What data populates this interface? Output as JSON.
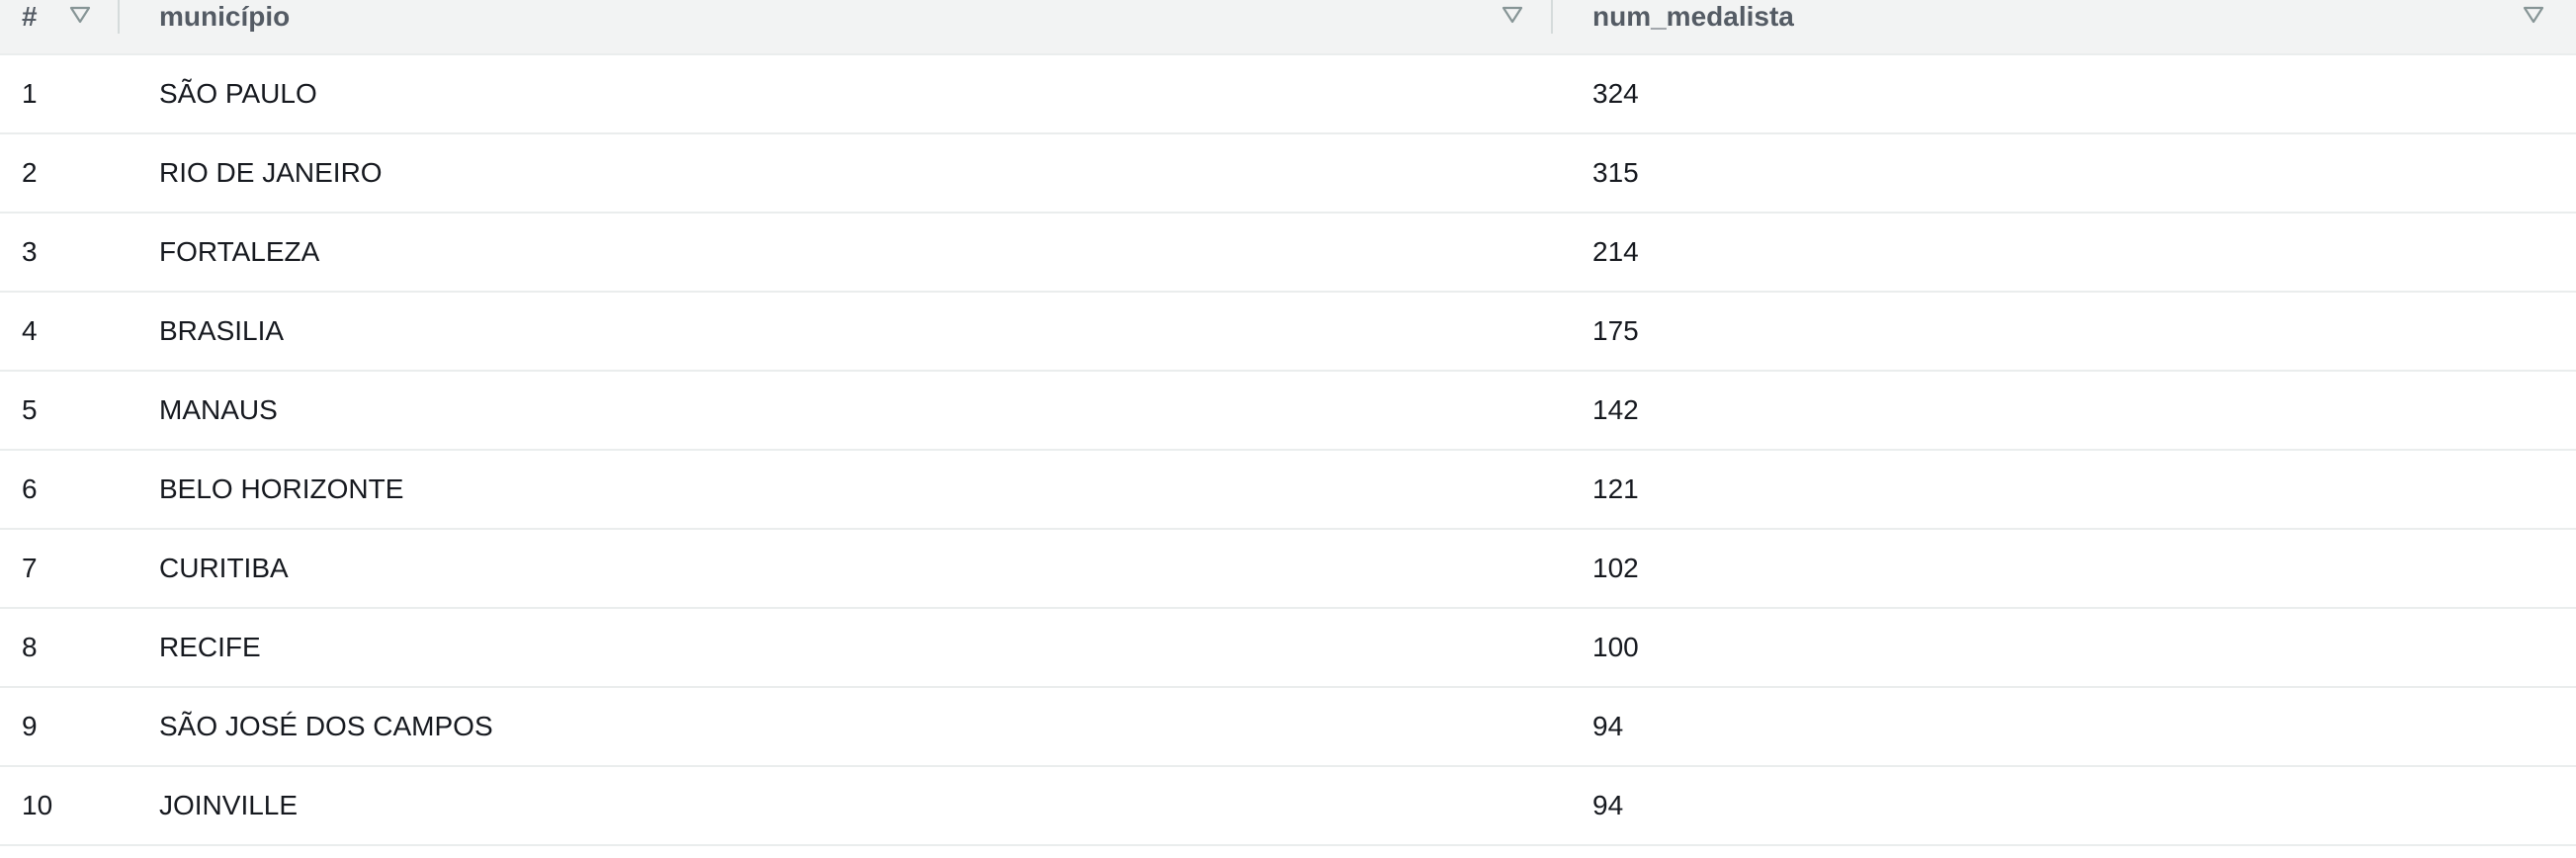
{
  "table": {
    "columns": [
      {
        "key": "index",
        "label": "#",
        "sort_icon": "sort-triangle-down-icon"
      },
      {
        "key": "municipio",
        "label": "município",
        "sort_icon": "sort-triangle-down-icon"
      },
      {
        "key": "num_medalista",
        "label": "num_medalista",
        "sort_icon": "sort-triangle-down-icon"
      }
    ],
    "rows": [
      {
        "index": "1",
        "municipio": "SÃO PAULO",
        "num_medalista": "324"
      },
      {
        "index": "2",
        "municipio": "RIO DE JANEIRO",
        "num_medalista": "315"
      },
      {
        "index": "3",
        "municipio": "FORTALEZA",
        "num_medalista": "214"
      },
      {
        "index": "4",
        "municipio": "BRASILIA",
        "num_medalista": "175"
      },
      {
        "index": "5",
        "municipio": "MANAUS",
        "num_medalista": "142"
      },
      {
        "index": "6",
        "municipio": "BELO HORIZONTE",
        "num_medalista": "121"
      },
      {
        "index": "7",
        "municipio": "CURITIBA",
        "num_medalista": "102"
      },
      {
        "index": "8",
        "municipio": "RECIFE",
        "num_medalista": "100"
      },
      {
        "index": "9",
        "municipio": "SÃO JOSÉ DOS CAMPOS",
        "num_medalista": "94"
      },
      {
        "index": "10",
        "municipio": "JOINVILLE",
        "num_medalista": "94"
      }
    ]
  },
  "colors": {
    "header_bg": "#f2f3f3",
    "header_text": "#545b64",
    "cell_text": "#16191f",
    "row_border": "#eaeded",
    "icon": "#879596"
  }
}
